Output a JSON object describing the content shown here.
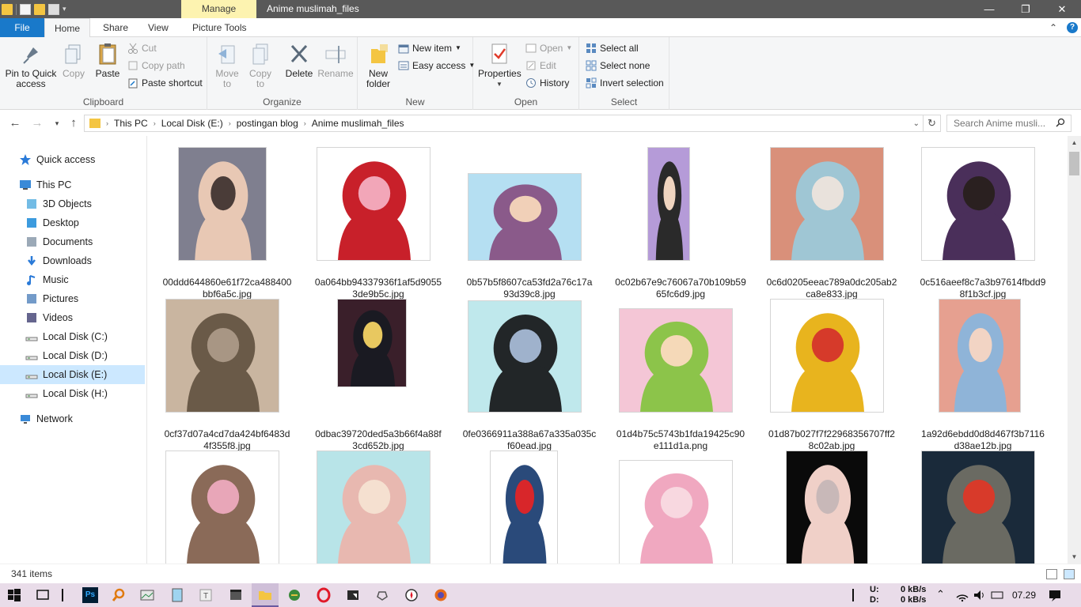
{
  "window": {
    "title": "Anime muslimah_files",
    "manage_tab": "Manage",
    "controls": {
      "minimize": "—",
      "maximize": "❐",
      "close": "✕"
    }
  },
  "ribbon_tabs": [
    "File",
    "Home",
    "Share",
    "View",
    "Picture Tools"
  ],
  "ribbon": {
    "clipboard": {
      "label": "Clipboard",
      "pin": "Pin to Quick access",
      "copy": "Copy",
      "paste": "Paste",
      "cut": "Cut",
      "copy_path": "Copy path",
      "paste_shortcut": "Paste shortcut"
    },
    "organize": {
      "label": "Organize",
      "move_to": "Move to",
      "copy_to": "Copy to",
      "delete": "Delete",
      "rename": "Rename"
    },
    "new": {
      "label": "New",
      "new_folder": "New folder",
      "new_item": "New item",
      "easy_access": "Easy access"
    },
    "open": {
      "label": "Open",
      "properties": "Properties",
      "open": "Open",
      "edit": "Edit",
      "history": "History"
    },
    "select": {
      "label": "Select",
      "select_all": "Select all",
      "select_none": "Select none",
      "invert": "Invert selection"
    }
  },
  "address": {
    "breadcrumbs": [
      "This PC",
      "Local Disk (E:)",
      "postingan blog",
      "Anime muslimah_files"
    ],
    "search_placeholder": "Search Anime musli..."
  },
  "nav_pane": [
    {
      "label": "Quick access",
      "icon": "star-icon"
    },
    {
      "label": "This PC",
      "icon": "computer-icon"
    },
    {
      "label": "3D Objects",
      "icon": "cube-icon"
    },
    {
      "label": "Desktop",
      "icon": "desktop-icon"
    },
    {
      "label": "Documents",
      "icon": "document-icon"
    },
    {
      "label": "Downloads",
      "icon": "download-icon"
    },
    {
      "label": "Music",
      "icon": "music-icon"
    },
    {
      "label": "Pictures",
      "icon": "pictures-icon"
    },
    {
      "label": "Videos",
      "icon": "videos-icon"
    },
    {
      "label": "Local Disk (C:)",
      "icon": "drive-icon"
    },
    {
      "label": "Local Disk (D:)",
      "icon": "drive-icon"
    },
    {
      "label": "Local Disk (E:)",
      "icon": "drive-icon",
      "selected": true
    },
    {
      "label": "Local Disk (H:)",
      "icon": "drive-icon"
    },
    {
      "label": "Network",
      "icon": "network-icon"
    }
  ],
  "files": [
    {
      "line1": "00ddd644860e61f72ca488400",
      "line2": "bbf6a5c.jpg",
      "colors": [
        "#7f7f8f",
        "#e8c8b4",
        "#4a3c38"
      ]
    },
    {
      "line1": "0a064bb94337936f1af5d9055",
      "line2": "3de9b5c.jpg",
      "colors": [
        "#ffffff",
        "#c8202a",
        "#f2a6b8"
      ]
    },
    {
      "line1": "0b57b5f8607ca53fd2a76c17a",
      "line2": "93d39c8.jpg",
      "colors": [
        "#b5dff2",
        "#8a5a8a",
        "#f1d0b8"
      ]
    },
    {
      "line1": "0c02b67e9c76067a70b109b59",
      "line2": "65fc6d9.jpg",
      "colors": [
        "#b59bd8",
        "#2a2a2a",
        "#f0d5c0"
      ]
    },
    {
      "line1": "0c6d0205eeac789a0dc205ab2",
      "line2": "ca8e833.jpg",
      "colors": [
        "#d9907a",
        "#9fc6d4",
        "#e9e2dc"
      ]
    },
    {
      "line1": "0c516aeef8c7a3b97614fbdd9",
      "line2": "8f1b3cf.jpg",
      "colors": [
        "#ffffff",
        "#4a2f5a",
        "#2a2020"
      ]
    },
    {
      "line1": "0cf37d07a4cd7da424bf6483d",
      "line2": "4f355f8.jpg",
      "colors": [
        "#c9b5a0",
        "#6a5a48",
        "#a89684"
      ]
    },
    {
      "line1": "0dbac39720ded5a3b66f4a88f",
      "line2": "3cd652b.jpg",
      "colors": [
        "#3a1f2a",
        "#1a1a22",
        "#e8c860"
      ]
    },
    {
      "line1": "0fe0366911a388a67a335a035c",
      "line2": "f60ead.jpg",
      "colors": [
        "#bfe8ec",
        "#222628",
        "#9fb2cc"
      ]
    },
    {
      "line1": "01d4b75c5743b1fda19425c90",
      "line2": "e111d1a.png",
      "colors": [
        "#f4c6d6",
        "#8cc44a",
        "#f5d9b8"
      ]
    },
    {
      "line1": "01d87b027f7f22968356707ff2",
      "line2": "8c02ab.jpg",
      "colors": [
        "#ffffff",
        "#e8b41e",
        "#d63a2a"
      ]
    },
    {
      "line1": "1a92d6ebdd0d8d467f3b7116",
      "line2": "d38ae12b.jpg",
      "colors": [
        "#e6a090",
        "#8fb4d8",
        "#f2d4c4"
      ]
    },
    {
      "line1": "",
      "line2": "",
      "colors": [
        "#ffffff",
        "#8a6a58",
        "#e8a6b8"
      ]
    },
    {
      "line1": "",
      "line2": "",
      "colors": [
        "#b8e4e8",
        "#e8b8b0",
        "#f5e0d0"
      ]
    },
    {
      "line1": "",
      "line2": "",
      "colors": [
        "#ffffff",
        "#2a4a7a",
        "#d8262a"
      ]
    },
    {
      "line1": "",
      "line2": "",
      "colors": [
        "#ffffff",
        "#f0a8c0",
        "#f8d8e0"
      ]
    },
    {
      "line1": "",
      "line2": "",
      "colors": [
        "#0a0a0a",
        "#f0d0c8",
        "#c8b8b8"
      ]
    },
    {
      "line1": "",
      "line2": "",
      "colors": [
        "#1a2a3a",
        "#6a6a62",
        "#d83a2a"
      ]
    }
  ],
  "status": {
    "count": "341 items"
  },
  "tray": {
    "up_label": "U:",
    "down_label": "D:",
    "up": "0 kB/s",
    "down": "0 kB/s",
    "time": "07.29"
  }
}
